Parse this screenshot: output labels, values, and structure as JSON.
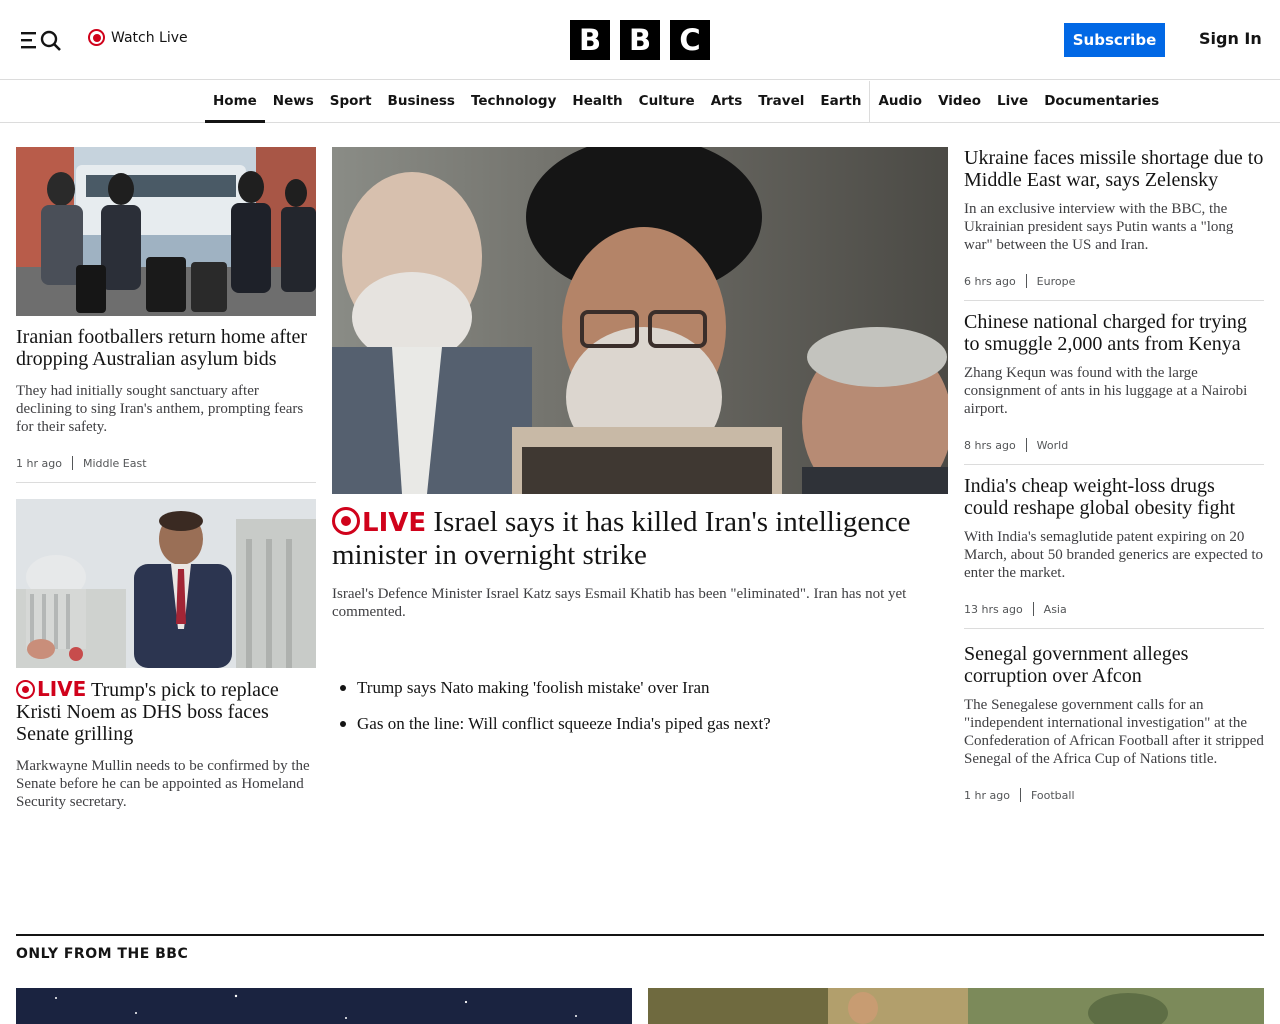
{
  "header": {
    "watch_live": "Watch Live",
    "logo": [
      "B",
      "B",
      "C"
    ],
    "subscribe": "Subscribe",
    "sign_in": "Sign In"
  },
  "nav": {
    "items": [
      "Home",
      "News",
      "Sport",
      "Business",
      "Technology",
      "Health",
      "Culture",
      "Arts",
      "Travel",
      "Earth",
      "Audio",
      "Video",
      "Live",
      "Documentaries"
    ],
    "active": "Home"
  },
  "left": {
    "story1": {
      "headline": "Iranian footballers return home after dropping Australian asylum bids",
      "desc": "They had initially sought sanctuary after declining to sing Iran's anthem, prompting fears for their safety.",
      "time": "1 hr ago",
      "tag": "Middle East"
    },
    "story2": {
      "live": "LIVE",
      "headline": "Trump's pick to replace Kristi Noem as DHS boss faces Senate grilling",
      "desc": "Markwayne Mullin needs to be confirmed by the Senate before he can be appointed as Homeland Security secretary."
    }
  },
  "center": {
    "live": "LIVE",
    "headline": "Israel says it has killed Iran's intelligence minister in overnight strike",
    "desc": "Israel's Defence Minister Israel Katz says Esmail Khatib has been \"eliminated\". Iran has not yet commented.",
    "related": [
      "Trump says Nato making 'foolish mistake' over Iran",
      "Gas on the line: Will conflict squeeze India's piped gas next?"
    ]
  },
  "right": [
    {
      "headline": "Ukraine faces missile shortage due to Middle East war, says Zelensky",
      "desc": "In an exclusive interview with the BBC, the Ukrainian president says Putin wants a \"long war\" between the US and Iran.",
      "time": "6 hrs ago",
      "tag": "Europe"
    },
    {
      "headline": "Chinese national charged for trying to smuggle 2,000 ants from Kenya",
      "desc": "Zhang Kequn was found with the large consignment of ants in his luggage at a Nairobi airport.",
      "time": "8 hrs ago",
      "tag": "World"
    },
    {
      "headline": "India's cheap weight-loss drugs could reshape global obesity fight",
      "desc": "With India's semaglutide patent expiring on 20 March, about 50 branded generics are expected to enter the market.",
      "time": "13 hrs ago",
      "tag": "Asia"
    },
    {
      "headline": "Senegal government alleges corruption over Afcon",
      "desc": "The Senegalese government calls for an \"independent international investigation\" at the Confederation of African Football after it stripped Senegal of the Africa Cup of Nations title.",
      "time": "1 hr ago",
      "tag": "Football"
    }
  ],
  "only_from": {
    "title": "ONLY FROM THE BBC"
  },
  "colors": {
    "accent_live": "#d0021b",
    "subscribe_bg": "#0168e5",
    "text": "#141414"
  }
}
